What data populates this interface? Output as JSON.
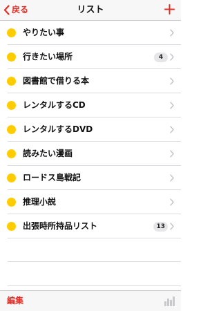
{
  "colors": {
    "accent": "#e0312a",
    "dot": "#ffcc00",
    "badge_bg": "#e6e6e9",
    "chevron": "#c4c4c8"
  },
  "navbar": {
    "back_label": "戻る",
    "title": "リスト",
    "back_icon": "chevron-left-icon",
    "add_icon": "plus-icon"
  },
  "list": {
    "items": [
      {
        "label": "やりたい事",
        "count": ""
      },
      {
        "label": "行きたい場所",
        "count": "4"
      },
      {
        "label": "図書館で借りる本",
        "count": ""
      },
      {
        "label": "レンタルするCD",
        "count": ""
      },
      {
        "label": "レンタルするDVD",
        "count": ""
      },
      {
        "label": "読みたい漫画",
        "count": ""
      },
      {
        "label": "ロードス島戦記",
        "count": ""
      },
      {
        "label": "推理小説",
        "count": ""
      },
      {
        "label": "出張時所持品リスト",
        "count": "13"
      }
    ]
  },
  "toolbar": {
    "edit_label": "編集",
    "stats_icon": "bar-chart-icon"
  }
}
